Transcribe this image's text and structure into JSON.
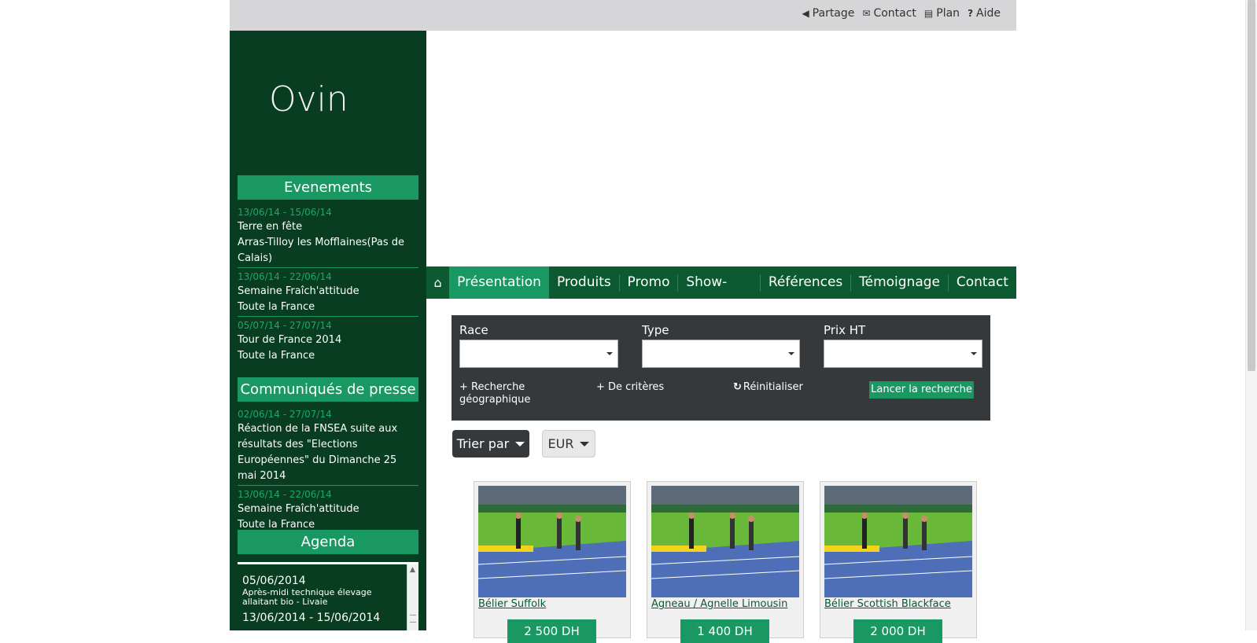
{
  "topbar": {
    "links": [
      {
        "icon": "share-icon",
        "label": "Partage"
      },
      {
        "icon": "envelope-icon",
        "label": "Contact"
      },
      {
        "icon": "sitemap-icon",
        "label": "Plan"
      },
      {
        "icon": "question-icon",
        "label": "Aide"
      }
    ]
  },
  "sidebar": {
    "brand": "Ovin",
    "events": {
      "title": "Evenements",
      "items": [
        {
          "date": "13/06/14 - 15/06/14",
          "name": "Terre en fête",
          "place": "Arras-Tilloy les Mofflaines(Pas de Calais)"
        },
        {
          "date": "13/06/14 - 22/06/14",
          "name": "Semaine Fraîch'attitude",
          "place": "Toute la France"
        },
        {
          "date": "05/07/14 - 27/07/14",
          "name": "Tour de France 2014",
          "place": "Toute la France"
        }
      ]
    },
    "press": {
      "title": "Communiqués de presse",
      "items": [
        {
          "date": "02/06/14 - 27/07/14",
          "name": "Réaction de la FNSEA suite aux résultats des \"Elections Européennes\" du Dimanche 25 mai 2014",
          "place": ""
        },
        {
          "date": "13/06/14 - 22/06/14",
          "name": "Semaine Fraîch'attitude",
          "place": "Toute la France"
        }
      ]
    },
    "agenda": {
      "title": "Agenda",
      "items": [
        {
          "date": "05/06/2014",
          "desc": "Après-midi technique élevage allaitant bio - Livaie"
        },
        {
          "date": "13/06/2014 - 15/06/2014",
          "desc": ""
        }
      ]
    }
  },
  "nav": {
    "home_icon": "home-icon",
    "items": [
      "Présentation",
      "Produits",
      "Promo",
      "Show-Room",
      "Références",
      "Témoignage",
      "Contact"
    ],
    "active": "Présentation"
  },
  "search": {
    "race_label": "Race",
    "type_label": "Type",
    "price_label": "Prix HT",
    "geo_link": "+ Recherche géographique",
    "criteria_link": "+ De critères",
    "reset_link": "Réinitialiser",
    "submit": "Lancer la recherche"
  },
  "sort": {
    "label": "Trier par",
    "currency": "EUR"
  },
  "products": [
    {
      "title": "Bélier Suffolk",
      "price": "2 500 DH"
    },
    {
      "title": "Agneau / Agnelle Limousin",
      "price": "1 400 DH"
    },
    {
      "title": "Bélier Scottish Blackface",
      "price": "2 000 DH"
    }
  ],
  "colors": {
    "dark_green": "#083d22",
    "accent": "#1a9863",
    "nav": "#0b5a32",
    "panel": "#36393b"
  }
}
